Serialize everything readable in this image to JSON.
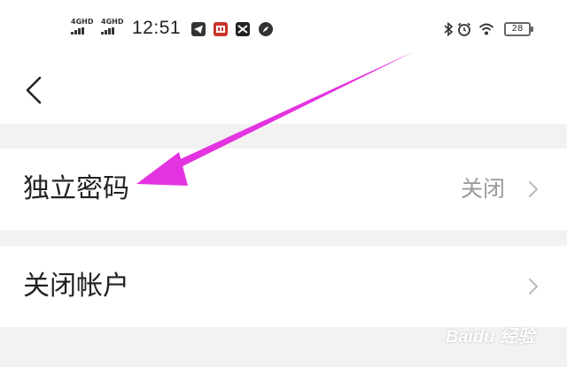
{
  "status_bar": {
    "network_1": "4GHD",
    "network_2": "4GHD",
    "time": "12:51",
    "battery": "28",
    "icons": [
      "telegram-icon",
      "app-badge-icon",
      "capcut-icon",
      "compass-icon",
      "bluetooth-icon",
      "alarm-icon",
      "wifi-icon",
      "battery-icon"
    ]
  },
  "header": {
    "back_icon": "chevron-left-icon"
  },
  "settings": {
    "rows": [
      {
        "label": "独立密码",
        "value": "关闭"
      },
      {
        "label": "关闭帐户",
        "value": ""
      }
    ]
  },
  "annotation": {
    "color": "#e433e0"
  },
  "watermark": {
    "text": "Baidu 经验"
  }
}
